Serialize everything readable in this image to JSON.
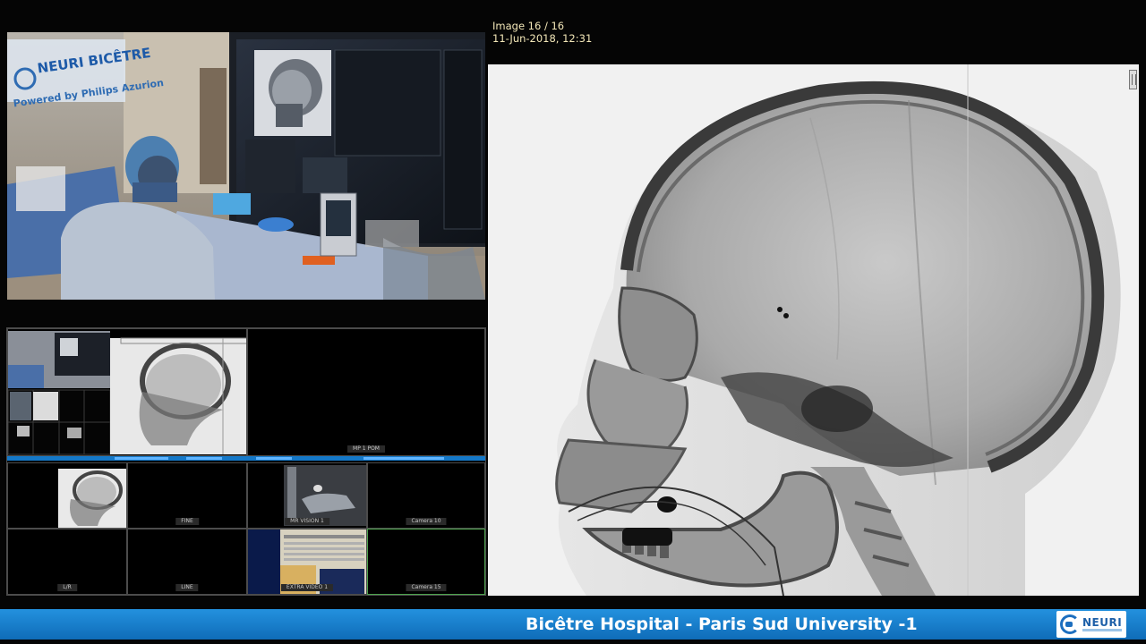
{
  "viewer": {
    "image_counter": "Image 16 / 16",
    "timestamp": "11-Jun-2018, 12:31"
  },
  "camera": {
    "banner_line1": "NEURI BICÊTRE",
    "banner_line2": "Powered by Philips Azurion"
  },
  "multiview": {
    "labels": {
      "cam1": "MP 1 POM",
      "cam2": "FINE",
      "cam3": "MR VISION 1",
      "cam4": "Camera 10",
      "cam5": "L/R",
      "cam6": "LINE",
      "cam7": "EXTRA VIDEO 1",
      "cam8": "Camera 15"
    }
  },
  "footer": {
    "title": "Bicêtre Hospital - Paris Sud University -1",
    "brand": "NEURI"
  },
  "colors": {
    "header_text": "#f3e7b8",
    "footer_bar": "#1478c8",
    "active_cell_border": "#4da34d"
  }
}
